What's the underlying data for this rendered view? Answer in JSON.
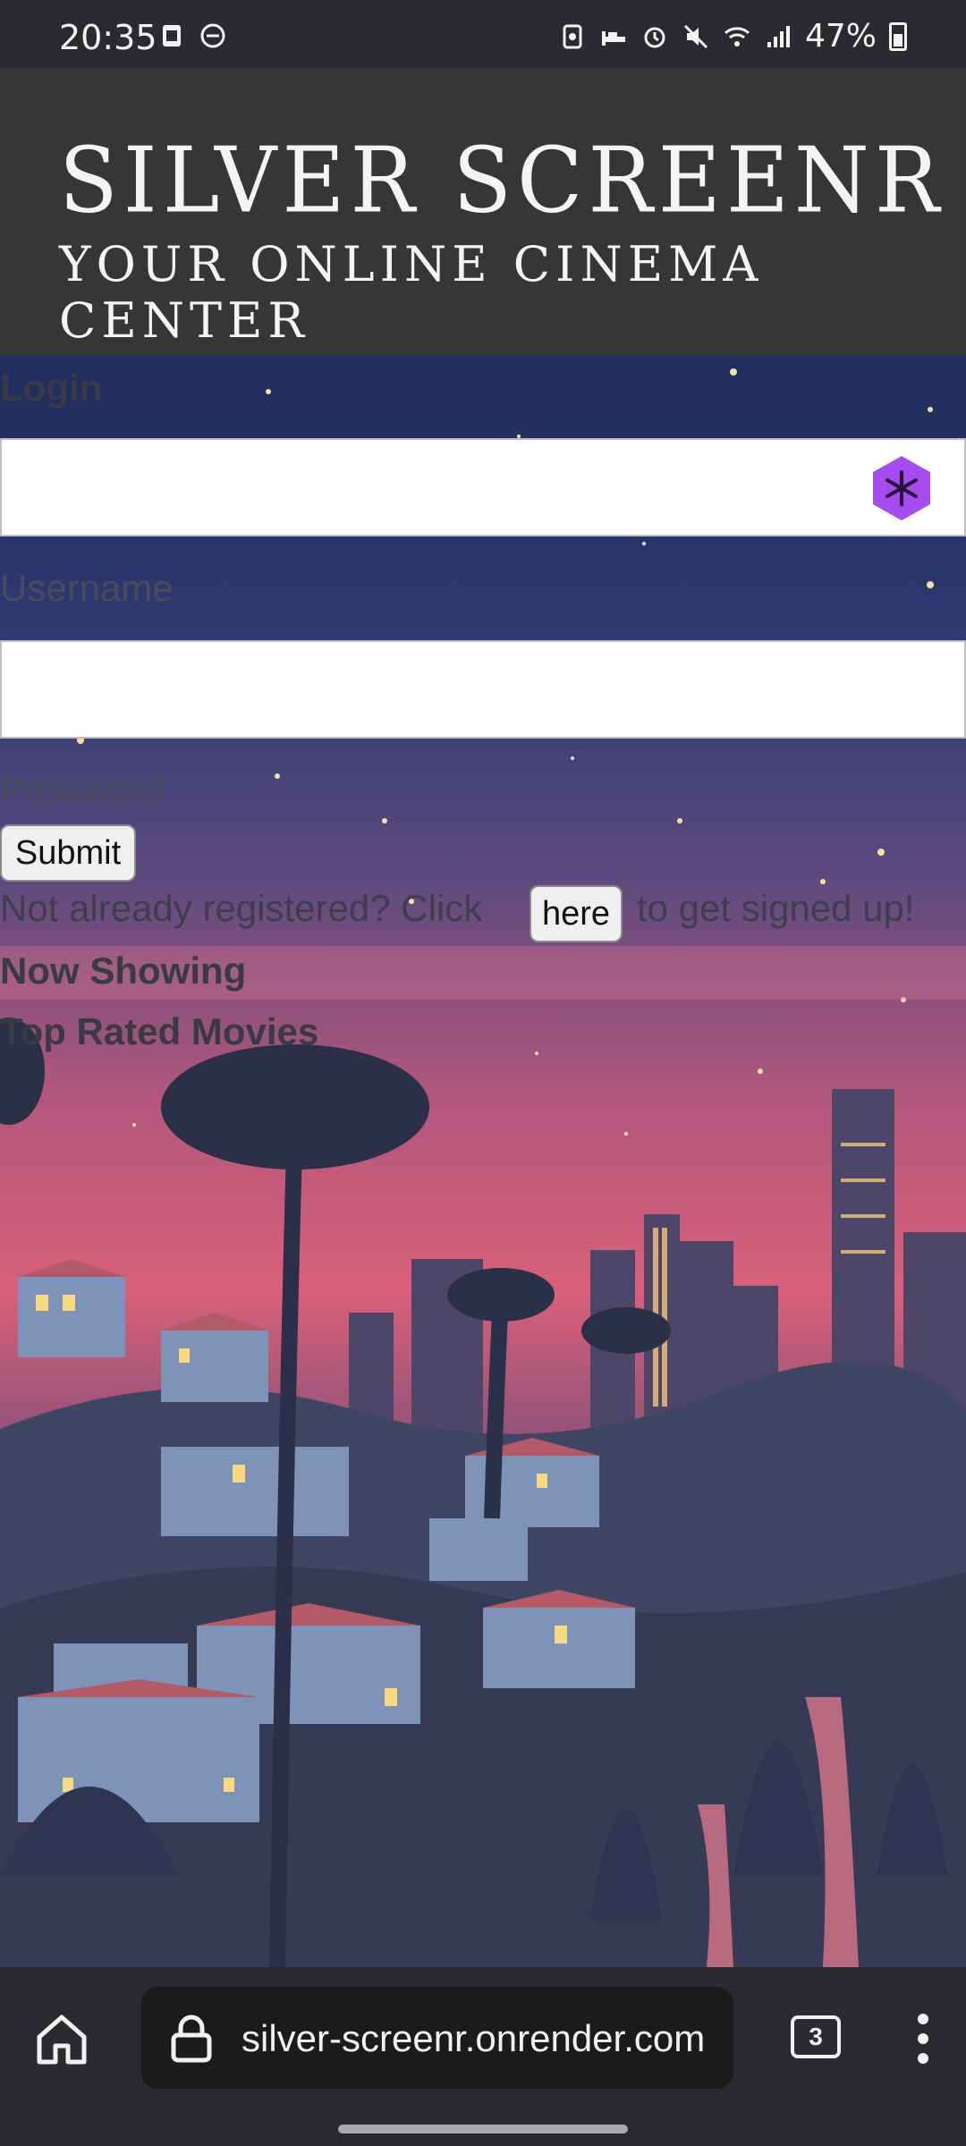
{
  "status_bar": {
    "time": "20:35",
    "battery": "47%",
    "icons": [
      "sim-card-icon",
      "dnd-icon",
      "recycle-icon",
      "sleep-icon",
      "alarm-icon",
      "mute-icon",
      "wifi-icon",
      "signal-icon",
      "battery-icon"
    ]
  },
  "header": {
    "title": "Silver Screenr",
    "tagline": "Your Online Cinema Center"
  },
  "form": {
    "login_label": "Login",
    "username_label": "Username",
    "password_label": "Password",
    "submit_label": "Submit",
    "signup_prefix": "Not already registered? Click",
    "signup_button": "here",
    "signup_suffix": "to get signed up!"
  },
  "nav": {
    "now_showing": "Now Showing",
    "top_rated": "Top Rated Movies"
  },
  "browser": {
    "url": "silver-screenr.onrender.com",
    "tab_count": "3"
  },
  "colors": {
    "header_bg": "#363636",
    "sky_top": "#1f2d5e",
    "sky_mid": "#5b4a7e",
    "sky_glow": "#d9607a",
    "extension_accent": "#a44cf0"
  }
}
